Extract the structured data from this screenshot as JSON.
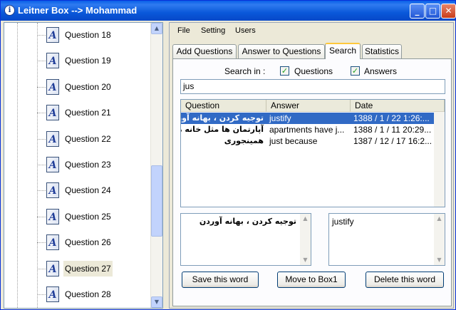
{
  "window": {
    "title": "Leitner Box --> Mohammad",
    "icon": "info-icon"
  },
  "title_buttons": [
    "minimize",
    "maximize",
    "close"
  ],
  "tree": {
    "items": [
      {
        "label": "Question 18",
        "selected": false
      },
      {
        "label": "Question 19",
        "selected": false
      },
      {
        "label": "Question 20",
        "selected": false
      },
      {
        "label": "Question 21",
        "selected": false
      },
      {
        "label": "Question 22",
        "selected": false
      },
      {
        "label": "Question 23",
        "selected": false
      },
      {
        "label": "Question 24",
        "selected": false
      },
      {
        "label": "Question 25",
        "selected": false
      },
      {
        "label": "Question 26",
        "selected": false
      },
      {
        "label": "Question 27",
        "selected": true
      },
      {
        "label": "Question 28",
        "selected": false
      }
    ],
    "icon_glyph": "A"
  },
  "menu": {
    "items": [
      "File",
      "Setting",
      "Users"
    ]
  },
  "tabs": {
    "items": [
      "Add Questions",
      "Answer to Questions",
      "Search",
      "Statistics"
    ],
    "active": "Search"
  },
  "search": {
    "search_in_label": "Search in :",
    "questions_label": "Questions",
    "questions_checked": true,
    "answers_label": "Answers",
    "answers_checked": true,
    "query": "jus"
  },
  "results": {
    "columns": [
      "Question",
      "Answer",
      "Date"
    ],
    "rows": [
      {
        "question": "توجیه کردن ، بهانه آوردن",
        "answer": "justify",
        "date": "1388 / 1 / 22   1:26:...",
        "selected": true
      },
      {
        "question": "آپارتمان ها مثل خانه ها",
        "answer": "apartments have j...",
        "date": "1388 / 1 / 11   20:29...",
        "selected": false
      },
      {
        "question": "همینجوری",
        "answer": "just because",
        "date": "1387 / 12 / 17   16:2...",
        "selected": false
      }
    ]
  },
  "detail": {
    "question_text": "توجیه کردن ، بهانه آوردن",
    "answer_text": "justify"
  },
  "buttons": {
    "save": "Save this word",
    "move": "Move to Box1",
    "delete": "Delete this word"
  }
}
